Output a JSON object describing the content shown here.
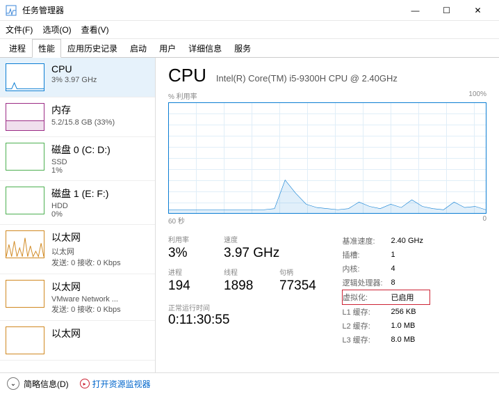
{
  "window": {
    "title": "任务管理器",
    "controls": {
      "min": "—",
      "max": "☐",
      "close": "✕"
    }
  },
  "menu": {
    "file": "文件(F)",
    "options": "选项(O)",
    "view": "查看(V)"
  },
  "tabs": {
    "processes": "进程",
    "performance": "性能",
    "history": "应用历史记录",
    "startup": "启动",
    "users": "用户",
    "details": "详细信息",
    "services": "服务"
  },
  "sidebar": [
    {
      "title": "CPU",
      "sub": "3%  3.97 GHz",
      "kind": "cpu",
      "selected": true
    },
    {
      "title": "内存",
      "sub": "5.2/15.8 GB (33%)",
      "kind": "mem"
    },
    {
      "title": "磁盘 0 (C: D:)",
      "sub": "SSD",
      "sub2": "1%",
      "kind": "disk"
    },
    {
      "title": "磁盘 1 (E: F:)",
      "sub": "HDD",
      "sub2": "0%",
      "kind": "disk"
    },
    {
      "title": "以太网",
      "sub": "以太网",
      "sub2": "发送: 0 接收: 0 Kbps",
      "kind": "eth"
    },
    {
      "title": "以太网",
      "sub": "VMware Network ...",
      "sub2": "发送: 0 接收: 0 Kbps",
      "kind": "eth"
    },
    {
      "title": "以太网",
      "sub": "",
      "kind": "eth"
    }
  ],
  "main": {
    "title": "CPU",
    "cpuName": "Intel(R) Core(TM) i5-9300H CPU @ 2.40GHz",
    "chartTopLeft": "% 利用率",
    "chartTopRight": "100%",
    "chartBottomLeft": "60 秒",
    "chartBottomRight": "0",
    "stats": {
      "util_label": "利用率",
      "util": "3%",
      "speed_label": "速度",
      "speed": "3.97 GHz",
      "proc_label": "进程",
      "proc": "194",
      "threads_label": "线程",
      "threads": "1898",
      "handles_label": "句柄",
      "handles": "77354",
      "uptime_label": "正常运行时间",
      "uptime": "0:11:30:55"
    },
    "right": {
      "base_speed_label": "基准速度:",
      "base_speed": "2.40 GHz",
      "sockets_label": "插槽:",
      "sockets": "1",
      "cores_label": "内核:",
      "cores": "4",
      "logical_label": "逻辑处理器:",
      "logical": "8",
      "virt_label": "虚拟化:",
      "virt": "已启用",
      "l1_label": "L1 缓存:",
      "l1": "256 KB",
      "l2_label": "L2 缓存:",
      "l2": "1.0 MB",
      "l3_label": "L3 缓存:",
      "l3": "8.0 MB"
    }
  },
  "footer": {
    "fewer": "简略信息(D)",
    "resmon": "打开资源监视器"
  },
  "chart_data": {
    "type": "line",
    "title": "% 利用率",
    "ylim": [
      0,
      100
    ],
    "xlabel_left": "60 秒",
    "xlabel_right": "0",
    "x_seconds_ago": [
      60,
      58,
      56,
      54,
      52,
      50,
      48,
      46,
      44,
      42,
      40,
      38,
      36,
      34,
      32,
      30,
      28,
      26,
      24,
      22,
      20,
      18,
      16,
      14,
      12,
      10,
      8,
      6,
      4,
      2,
      0
    ],
    "values": [
      3,
      3,
      3,
      3,
      3,
      3,
      3,
      3,
      3,
      3,
      4,
      30,
      18,
      8,
      5,
      4,
      3,
      4,
      10,
      6,
      4,
      8,
      5,
      12,
      6,
      4,
      3,
      10,
      5,
      6,
      3
    ]
  }
}
